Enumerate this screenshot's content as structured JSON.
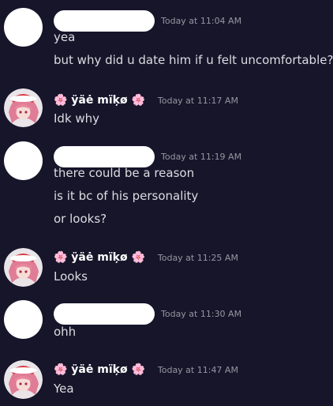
{
  "messages": [
    {
      "author": "",
      "timestamp": "Today at 11:04 AM",
      "lines": [
        "yea",
        "but why did u date him if u felt uncomfortable?"
      ],
      "avatar": "blank"
    },
    {
      "author": "🌸 ÿäė mïķø 🌸",
      "timestamp": "Today at 11:17 AM",
      "lines": [
        "Idk why"
      ],
      "avatar": "anime"
    },
    {
      "author": "",
      "timestamp": "Today at 11:19 AM",
      "lines": [
        "there could be a reason",
        "is it bc of his personality",
        "or looks?"
      ],
      "avatar": "blank"
    },
    {
      "author": "🌸 ÿäė mïķø 🌸",
      "timestamp": "Today at 11:25 AM",
      "lines": [
        "Looks"
      ],
      "avatar": "anime"
    },
    {
      "author": "",
      "timestamp": "Today at 11:30 AM",
      "lines": [
        "ohh"
      ],
      "avatar": "blank"
    },
    {
      "author": "🌸 ÿäė mïķø 🌸",
      "timestamp": "Today at 11:47 AM",
      "lines": [
        "Yea"
      ],
      "avatar": "anime"
    }
  ],
  "colors": {
    "background": "#16152a",
    "text": "#dcdde2",
    "timestamp": "#9596a0",
    "redaction": "#ffffff"
  }
}
